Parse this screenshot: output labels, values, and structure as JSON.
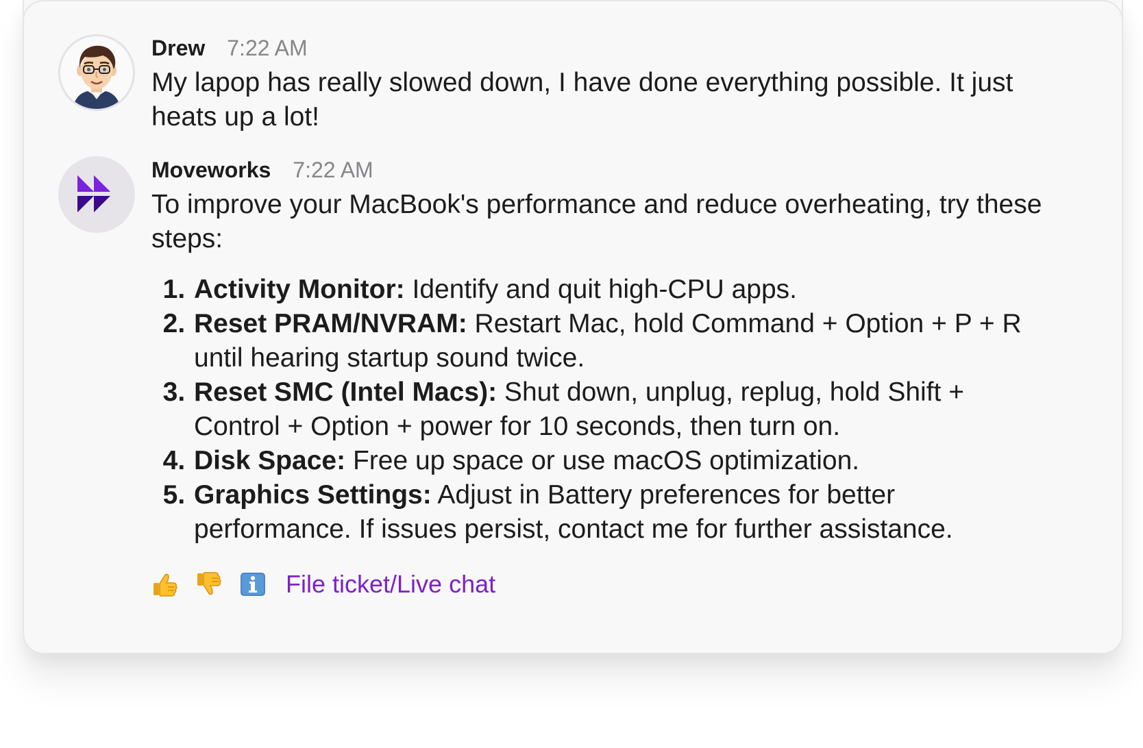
{
  "messages": [
    {
      "sender": "Drew",
      "time": "7:22 AM",
      "text": "My lapop has really slowed down, I have done everything possible. It just heats up a lot!"
    },
    {
      "sender": "Moveworks",
      "time": "7:22 AM",
      "intro": "To improve your MacBook's performance and reduce overheating, try these steps:",
      "steps": [
        {
          "title": "Activity Monitor:",
          "text": " Identify and quit high-CPU apps."
        },
        {
          "title": "Reset PRAM/NVRAM:",
          "text": " Restart Mac, hold Command + Option + P + R until hearing startup sound twice."
        },
        {
          "title": "Reset SMC (Intel Macs):",
          "text": " Shut down, unplug, replug, hold Shift + Control + Option + power for 10 seconds, then turn on."
        },
        {
          "title": "Disk Space:",
          "text": " Free up space or use macOS optimization."
        },
        {
          "title": "Graphics Settings:",
          "text": " Adjust in Battery preferences for better performance. If issues persist, contact me for further assistance."
        }
      ],
      "actions": {
        "thumbs_up_icon": "thumbs-up-icon",
        "thumbs_down_icon": "thumbs-down-icon",
        "info_icon": "info-icon",
        "link_label": "File ticket/Live chat"
      }
    }
  ],
  "colors": {
    "link": "#7c22c6",
    "brand_purple": "#6e1bd0",
    "brand_dark": "#3b0a8a"
  }
}
